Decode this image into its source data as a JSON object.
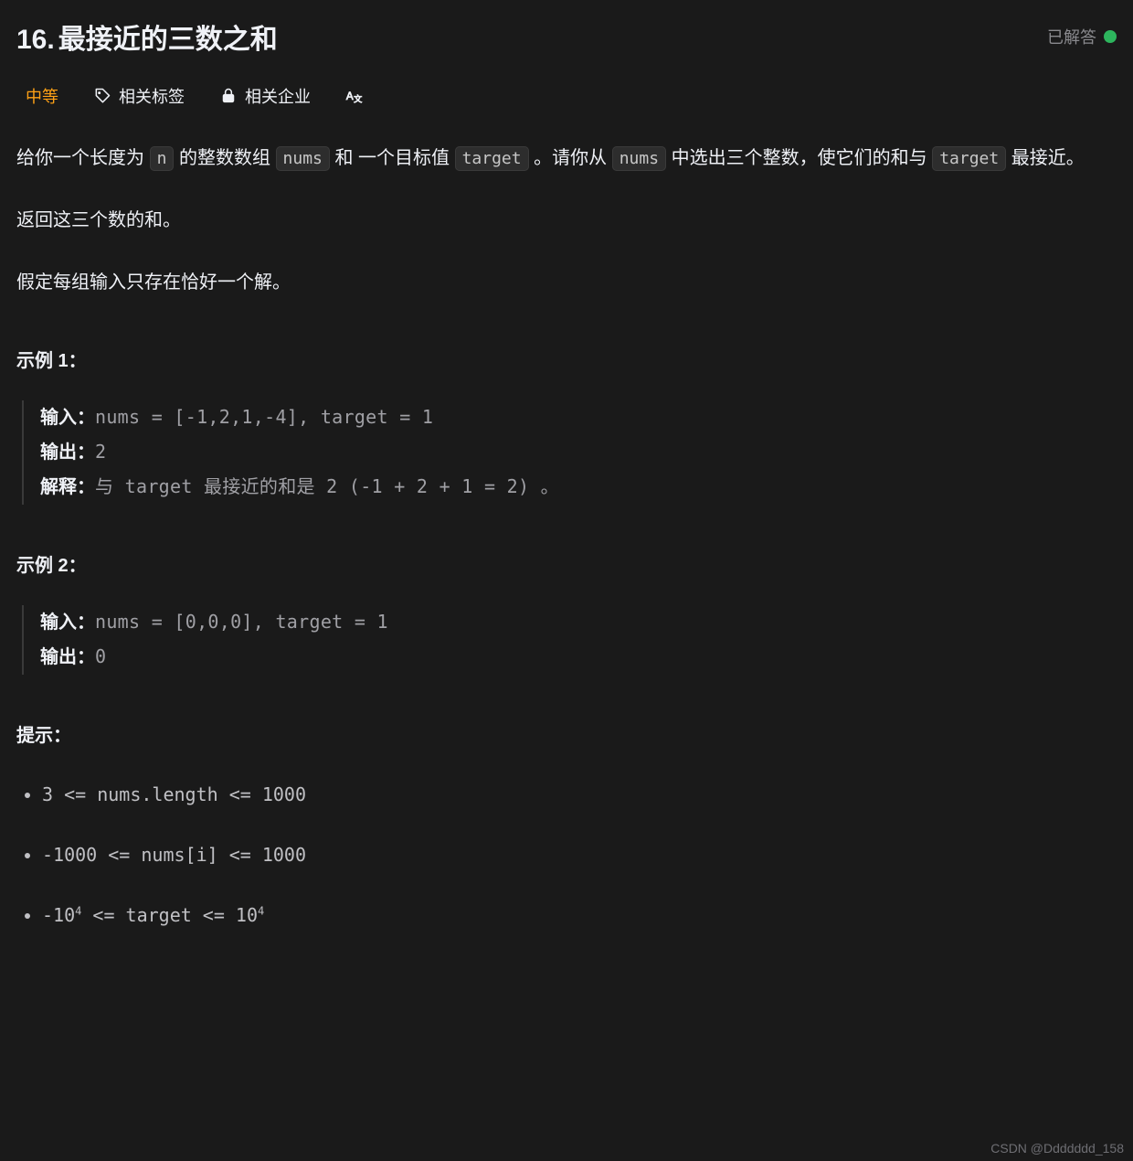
{
  "header": {
    "number": "16.",
    "title": "最接近的三数之和",
    "solved_label": "已解答"
  },
  "tabs": {
    "difficulty": "中等",
    "tags": "相关标签",
    "companies": "相关企业"
  },
  "description": {
    "p1_a": "给你一个长度为 ",
    "p1_code1": "n",
    "p1_b": " 的整数数组 ",
    "p1_code2": "nums",
    "p1_c": " 和 一个目标值 ",
    "p1_code3": "target",
    "p1_d": " 。请你从 ",
    "p1_code4": "nums",
    "p1_e": " 中选出三个整数，使它们的和与 ",
    "p1_code5": "target",
    "p1_f": " 最接近。",
    "p2": "返回这三个数的和。",
    "p3": "假定每组输入只存在恰好一个解。"
  },
  "examples": {
    "label1": "示例 1：",
    "label2": "示例 2：",
    "input_label": "输入：",
    "output_label": "输出：",
    "explain_label": "解释：",
    "ex1_input": "nums = [-1,2,1,-4], target = 1",
    "ex1_output": "2",
    "ex1_explain": "与 target 最接近的和是 2 (-1 + 2 + 1 = 2) 。",
    "ex2_input": "nums = [0,0,0], target = 1",
    "ex2_output": "0"
  },
  "hints": {
    "label": "提示：",
    "items": [
      "3 <= nums.length <= 1000",
      "-1000 <= nums[i] <= 1000",
      "-10^4 <= target <= 10^4"
    ]
  },
  "watermark": "CSDN @Ddddddd_158"
}
